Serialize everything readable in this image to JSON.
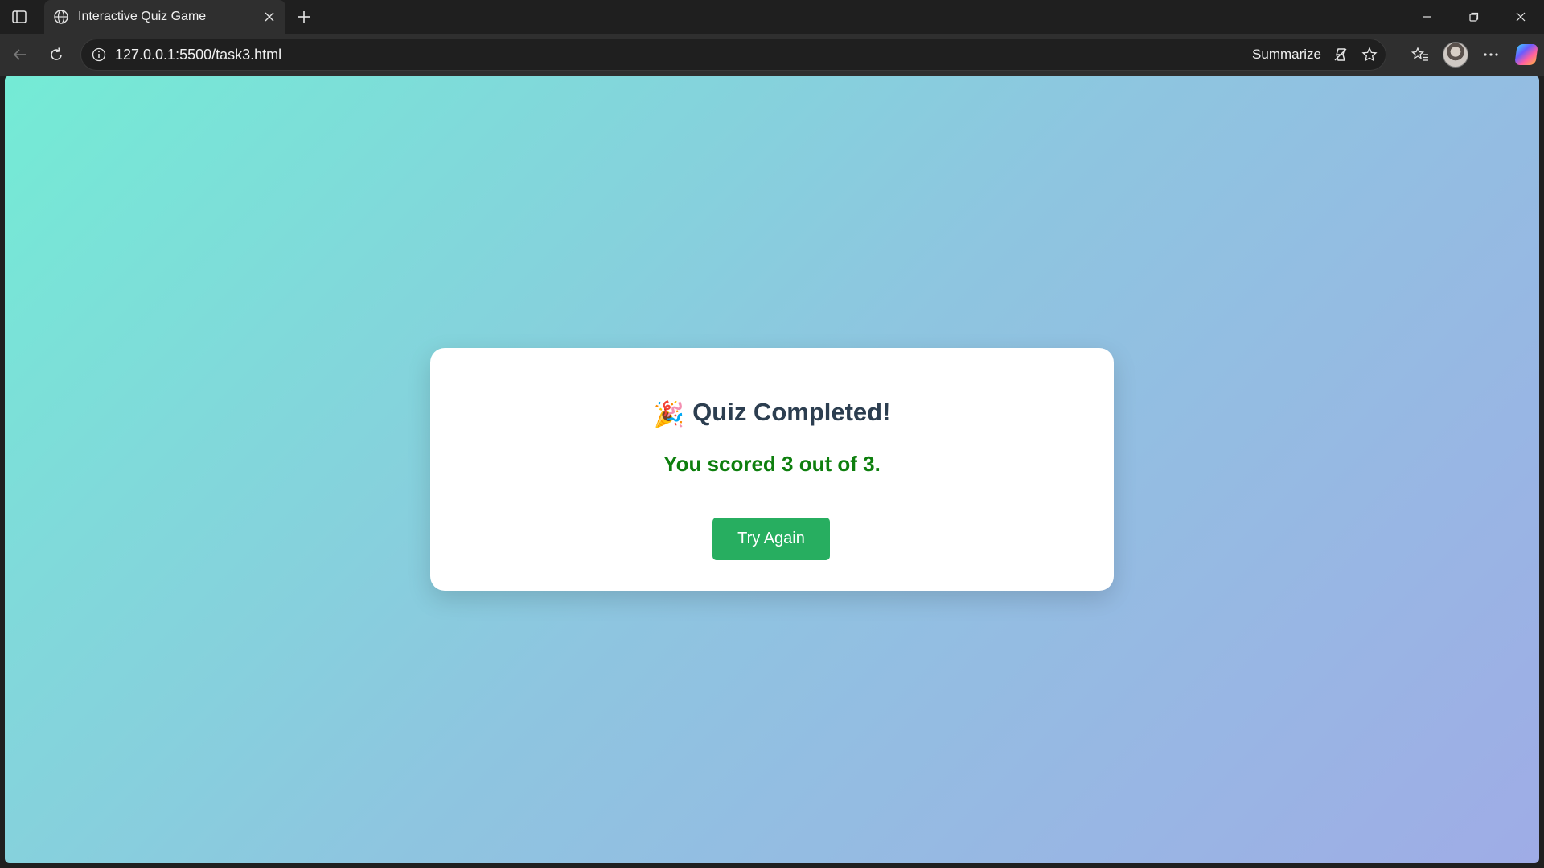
{
  "browser": {
    "tab_title": "Interactive Quiz Game",
    "url": "127.0.0.1:5500/task3.html",
    "summarize_label": "Summarize"
  },
  "quiz": {
    "title": "Quiz Completed!",
    "title_emoji": "🎉",
    "score_text": "You scored 3 out of 3.",
    "try_again_label": "Try Again",
    "score": 3,
    "total": 3
  },
  "colors": {
    "gradient_start": "#74ebd5",
    "gradient_end": "#9face6",
    "title_color": "#2c3e50",
    "score_color": "#0e7f0e",
    "button_color": "#27ae60"
  },
  "icons": {
    "sidebar_toggle": "sidebar-toggle-icon",
    "tab_favicon": "globe-icon",
    "tab_close": "close-icon",
    "new_tab": "plus-icon",
    "back": "back-arrow-icon",
    "refresh": "refresh-icon",
    "site_info": "info-icon",
    "summarize_action": "summarize-icon",
    "favorite": "star-icon",
    "favorites_list": "favorites-icon",
    "profile": "avatar",
    "more": "more-icon",
    "copilot": "copilot-icon"
  }
}
